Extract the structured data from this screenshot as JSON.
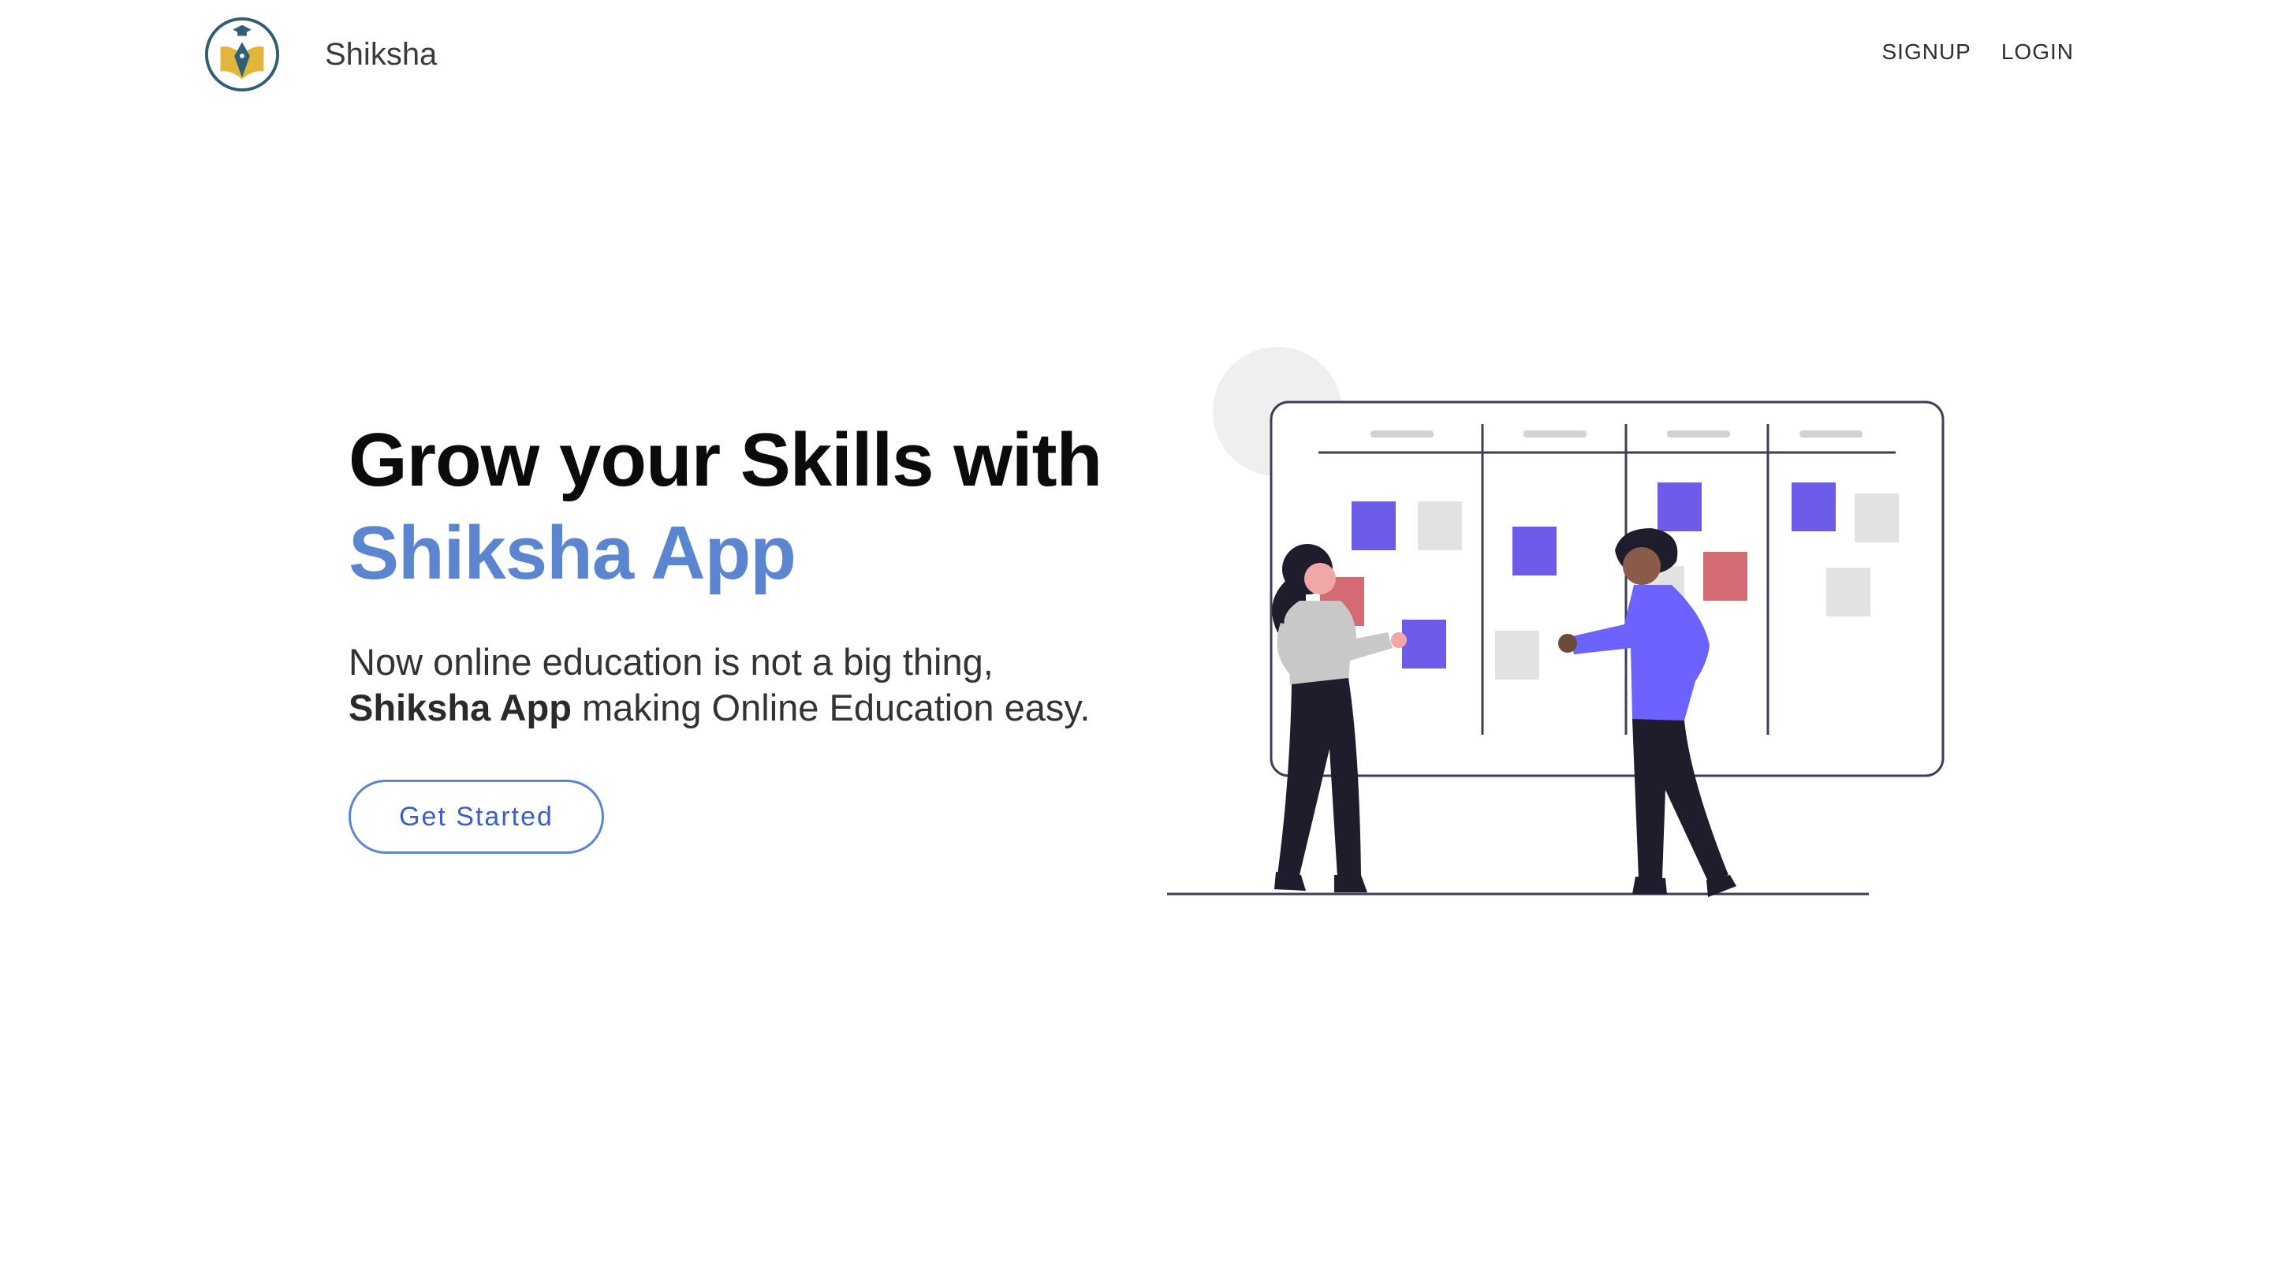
{
  "header": {
    "brand_name": "Shiksha",
    "nav": [
      {
        "label": "SIGNUP"
      },
      {
        "label": "LOGIN"
      }
    ]
  },
  "hero": {
    "headline_line1": "Grow your Skills with",
    "headline_line2": "Shiksha App",
    "sub_line1": "Now online education is not a big thing,",
    "sub_bold": "Shiksha App",
    "sub_line2_rest": " making Online Education easy.",
    "cta_label": "Get Started"
  },
  "colors": {
    "accent_blue": "#5b86cf",
    "cta_text": "#3b5fc8",
    "card_purple": "#6c5ce7",
    "card_red": "#d46a72",
    "card_grey": "#e2e2e2"
  },
  "icons": {
    "logo": "graduation-cap-pen-logo",
    "illustration": "kanban-board-team-illustration"
  }
}
